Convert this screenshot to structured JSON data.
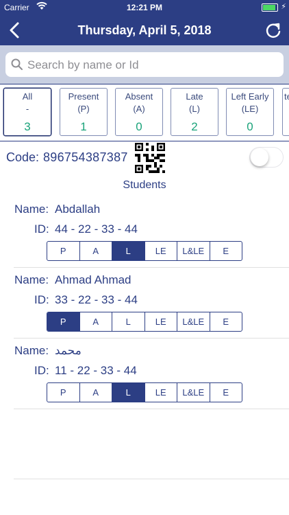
{
  "status_bar": {
    "carrier": "Carrier",
    "time": "12:21 PM"
  },
  "nav": {
    "title": "Thursday, April 5, 2018",
    "back_icon": "chevron-left-icon",
    "refresh_icon": "refresh-icon"
  },
  "search": {
    "placeholder": "Search by name or Id",
    "value": ""
  },
  "filters": [
    {
      "label": "All",
      "abbr": "-",
      "count": "3",
      "active": true
    },
    {
      "label": "Present",
      "abbr": "(P)",
      "count": "1",
      "active": false
    },
    {
      "label": "Absent",
      "abbr": "(A)",
      "count": "0",
      "active": false
    },
    {
      "label": "Late",
      "abbr": "(L)",
      "count": "2",
      "active": false
    },
    {
      "label": "Left Early",
      "abbr": "(LE)",
      "count": "0",
      "active": false
    },
    {
      "label": "te",
      "abbr": "",
      "count": "",
      "active": false
    }
  ],
  "code": {
    "label": "Code:",
    "value": "896754387387",
    "toggle_on": false
  },
  "students_heading": "Students",
  "labels": {
    "name": "Name:",
    "id": "ID:"
  },
  "status_options": [
    "P",
    "A",
    "L",
    "LE",
    "L&LE",
    "E"
  ],
  "students": [
    {
      "name": "Abdallah",
      "id": "44 - 22 - 33 - 44",
      "selected": "L"
    },
    {
      "name": "Ahmad Ahmad",
      "id": "33 - 22 - 33 - 44",
      "selected": "P"
    },
    {
      "name": "محمد",
      "id": "11 - 22 - 33 - 44",
      "selected": "L"
    }
  ],
  "colors": {
    "primary": "#2c3e84",
    "count": "#1aa37a",
    "search_bg": "#c8cfe1"
  }
}
